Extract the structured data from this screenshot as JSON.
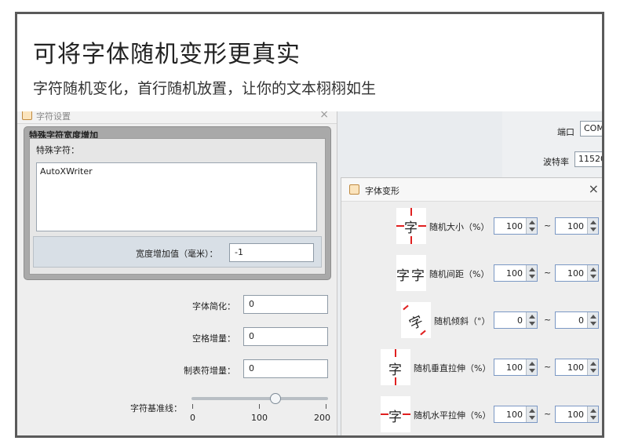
{
  "banner": {
    "title": "可将字体随机变形更真实",
    "subtitle": "字符随机变化，首行随机放置，让你的文本栩栩如生"
  },
  "background_window": {
    "port_label": "端口",
    "port_value": "COM",
    "baud_label": "波特率",
    "baud_value": "11520"
  },
  "char_settings": {
    "title": "字符设置",
    "group_title": "特殊字符宽度增加",
    "special_chars_label": "特殊字符：",
    "special_chars_value": "AutoXWriter",
    "width_increase_label": "宽度增加值（毫米）：",
    "width_increase_value": "-1",
    "simplify_label": "字体简化：",
    "simplify_value": "0",
    "space_label": "空格增量：",
    "space_value": "0",
    "tab_label": "制表符增量：",
    "tab_value": "0",
    "baseline_label": "字符基准线：",
    "baseline_ticks": [
      "0",
      "100",
      "200"
    ],
    "baseline_value": 125
  },
  "transform": {
    "title": "字体变形",
    "tilde": "~",
    "glyph": "字",
    "rows": [
      {
        "label": "随机大小（%）",
        "min": "100",
        "max": "100",
        "icon": "size-icon"
      },
      {
        "label": "随机间距（%）",
        "min": "100",
        "max": "100",
        "icon": "spacing-icon"
      },
      {
        "label": "随机倾斜（°）",
        "min": "0",
        "max": "0",
        "icon": "tilt-icon"
      },
      {
        "label": "随机垂直拉伸（%）",
        "min": "100",
        "max": "100",
        "icon": "vertical-stretch-icon"
      },
      {
        "label": "随机水平拉伸（%）",
        "min": "100",
        "max": "100",
        "icon": "horizontal-stretch-icon"
      }
    ]
  },
  "close_symbol": "×"
}
